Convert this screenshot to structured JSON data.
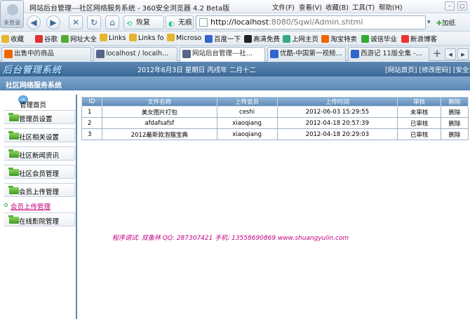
{
  "browser": {
    "window_title": "网站后台管理---社区网络服务系统 - 360安全浏览器 4.2 Beta版",
    "avatar_caption": "未登录",
    "menu": [
      "文件(F)",
      "查看(V)",
      "收藏(B)",
      "工具(T)",
      "帮助(H)"
    ],
    "toolbar": {
      "back": "◀",
      "forward": "▶",
      "stop": "✕",
      "refresh": "↻",
      "home": "⌂",
      "restore_label": "恢复",
      "no_trace_label": "无痕"
    },
    "address": {
      "url_host": "http://localhost",
      "url_rest": ":8080/Sqwl/Admin.shtml",
      "add_fav": "加纸"
    },
    "bookmarks": [
      {
        "label": "收藏",
        "color": "#e8b530"
      },
      {
        "label": "谷歌",
        "color": "#d33"
      },
      {
        "label": "网址大全",
        "color": "#5a3"
      },
      {
        "label": "Links",
        "color": "#e8b530"
      },
      {
        "label": "Links fo",
        "color": "#e8b530"
      },
      {
        "label": "Microso",
        "color": "#e8b530"
      },
      {
        "label": "百度一下",
        "color": "#36c"
      },
      {
        "label": "高清免费",
        "color": "#222"
      },
      {
        "label": "上网主页",
        "color": "#3a8"
      },
      {
        "label": "淘宝特卖",
        "color": "#e60"
      },
      {
        "label": "诚信毕业",
        "color": "#3a3"
      },
      {
        "label": "新浪博客",
        "color": "#e33"
      }
    ],
    "tabs": [
      {
        "label": "出售中的商品",
        "color": "#e60",
        "active": false
      },
      {
        "label": "localhost / localh...",
        "color": "#568",
        "active": false
      },
      {
        "label": "网站后台管理---社...",
        "color": "#568",
        "active": true
      },
      {
        "label": "优酷-中国第一视频...",
        "color": "#36c",
        "active": false
      },
      {
        "label": "西游记 11版全集 -...",
        "color": "#36c",
        "active": false
      }
    ]
  },
  "site": {
    "logo": "后台管理系统",
    "date_line": "2012年6月3日  星期日  丙戌年  二月十二",
    "top_links": "[网站首页] [修改密码] [安全退",
    "section_title": "社区网络服务系统",
    "sidebar": {
      "home_label": "管理首页",
      "items": [
        "管理员设置",
        "社区相关设置",
        "社区新闻资讯",
        "社区会员管理",
        "会员上传管理"
      ],
      "active_link": "会员上传管理",
      "last_item": "在线影院管理"
    },
    "table": {
      "headers": [
        "ID",
        "文件名称",
        "上传会员",
        "上传时间",
        "审核",
        "删除"
      ],
      "rows": [
        [
          "1",
          "美女图片打包",
          "ceshi",
          "2012-06-03 15:29:55",
          "未审核",
          "删除"
        ],
        [
          "2",
          "afdafsafsf",
          "xiaoqiang",
          "2012-04-18 20:57:39",
          "已审核",
          "删除"
        ],
        [
          "3",
          "2012最新款泡猫宝典",
          "xiaoqiang",
          "2012-04-18 20:29:03",
          "已审核",
          "删除"
        ]
      ]
    },
    "credit": "程序调试: 双鱼林  QQ: 287307421  手机: 13558690869  www.shuangyulin.com"
  }
}
